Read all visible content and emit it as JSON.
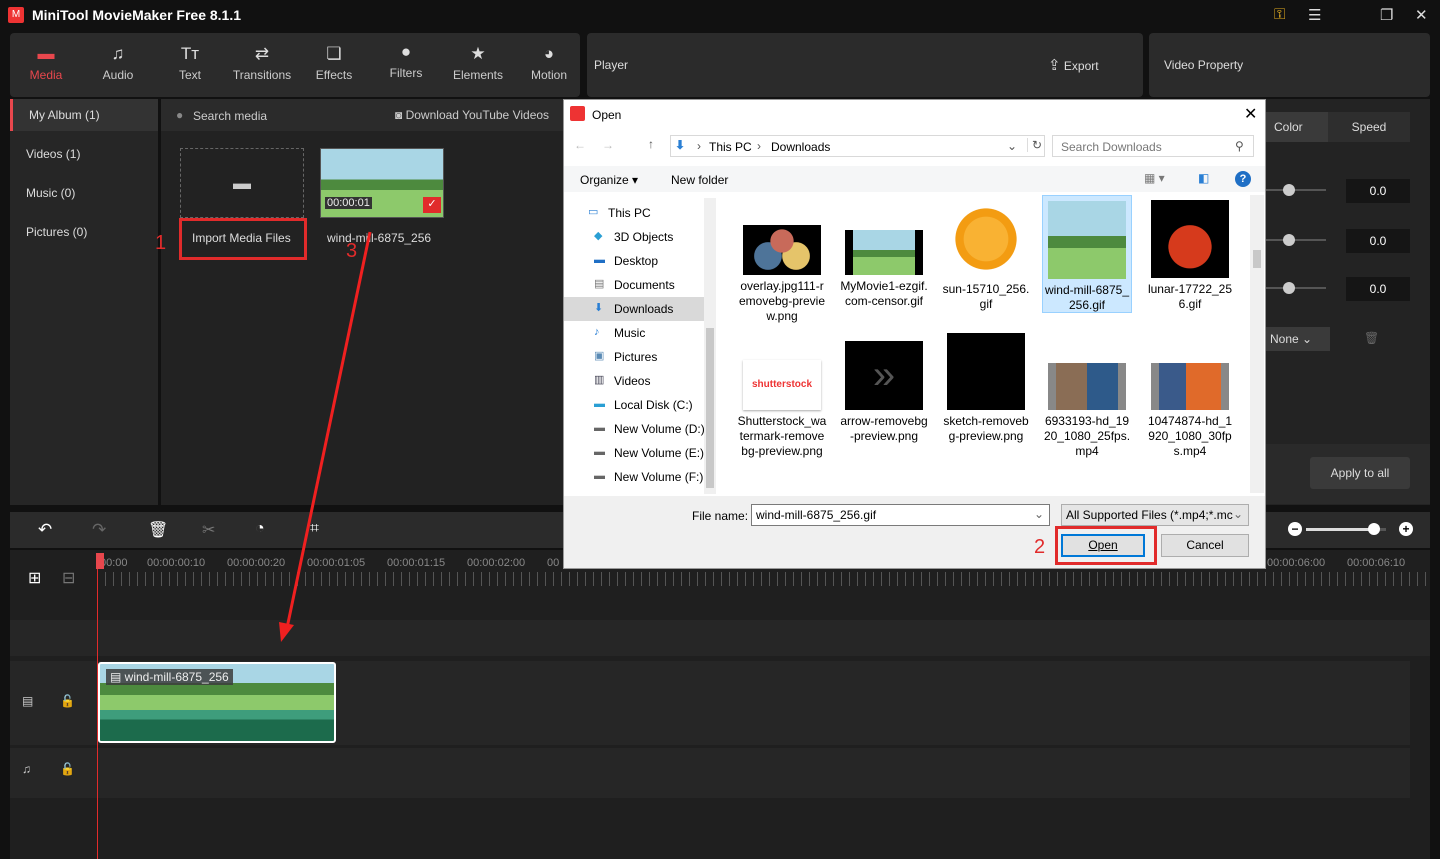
{
  "app": {
    "title": "MiniTool MovieMaker Free 8.1.1",
    "window_controls": [
      "key-icon",
      "menu-icon",
      "restore-icon",
      "close-icon"
    ]
  },
  "toolbar": {
    "items": [
      {
        "label": "Media",
        "icon": "folder-icon",
        "active": true
      },
      {
        "label": "Audio",
        "icon": "music-icon"
      },
      {
        "label": "Text",
        "icon": "text-icon"
      },
      {
        "label": "Transitions",
        "icon": "transitions-icon"
      },
      {
        "label": "Effects",
        "icon": "effects-icon"
      },
      {
        "label": "Filters",
        "icon": "filters-icon"
      },
      {
        "label": "Elements",
        "icon": "elements-icon"
      },
      {
        "label": "Motion",
        "icon": "motion-icon"
      }
    ]
  },
  "player": {
    "title": "Player",
    "export_label": "Export"
  },
  "property": {
    "title": "Video Property",
    "tabs": [
      "Color",
      "Speed"
    ],
    "values": [
      "0.0",
      "0.0",
      "0.0"
    ],
    "slider_levels": [
      0.5,
      0.5,
      0.5
    ],
    "preset": "None",
    "apply_all": "Apply to all"
  },
  "sidebar": {
    "items": [
      "My Album (1)",
      "Videos (1)",
      "Music (0)",
      "Pictures (0)"
    ]
  },
  "media": {
    "search_placeholder": "Search media",
    "download_label": "Download YouTube Videos",
    "import_label": "Import Media Files",
    "clip_name": "wind-mill-6875_256",
    "clip_duration": "00:00:01"
  },
  "timeline": {
    "ruler": [
      "00:00",
      "00:00:00:10",
      "00:00:00:20",
      "00:00:01:05",
      "00:00:01:15",
      "00:00:02:00",
      "00",
      "00:00:06:00",
      "00:00:06:10"
    ],
    "clip_label": "wind-mill-6875_256",
    "zoom_level": 0.85
  },
  "dialog": {
    "title": "Open",
    "path": [
      "This PC",
      "Downloads"
    ],
    "search_placeholder": "Search Downloads",
    "organize": "Organize",
    "new_folder": "New folder",
    "nav": [
      {
        "label": "This PC",
        "icon": "pc-icon"
      },
      {
        "label": "3D Objects",
        "icon": "cube-icon"
      },
      {
        "label": "Desktop",
        "icon": "desktop-icon"
      },
      {
        "label": "Documents",
        "icon": "documents-icon"
      },
      {
        "label": "Downloads",
        "icon": "download-icon"
      },
      {
        "label": "Music",
        "icon": "music-icon"
      },
      {
        "label": "Pictures",
        "icon": "pictures-icon"
      },
      {
        "label": "Videos",
        "icon": "videos-icon"
      },
      {
        "label": "Local Disk (C:)",
        "icon": "disk-icon"
      },
      {
        "label": "New Volume (D:)",
        "icon": "drive-icon"
      },
      {
        "label": "New Volume (E:)",
        "icon": "drive-icon"
      },
      {
        "label": "New Volume (F:)",
        "icon": "drive-icon"
      }
    ],
    "files": [
      "overlay.jpg111-removebg-preview.png",
      "MyMovie1-ezgif.com-censor.gif",
      "sun-15710_256.gif",
      "wind-mill-6875_256.gif",
      "lunar-17722_256.gif",
      "Shutterstock_watermark-removebg-preview.png",
      "arrow-removebg-preview.png",
      "sketch-removebg-preview.png",
      "6933193-hd_1920_1080_25fps.mp4",
      "10474874-hd_1920_1080_30fps.mp4"
    ],
    "shutterstock_text": "shutterstock",
    "file_name_label": "File name:",
    "file_name": "wind-mill-6875_256.gif",
    "file_type": "All Supported Files (*.mp4;*.mc",
    "open": "Open",
    "cancel": "Cancel"
  },
  "annotations": [
    "1",
    "2",
    "3"
  ]
}
